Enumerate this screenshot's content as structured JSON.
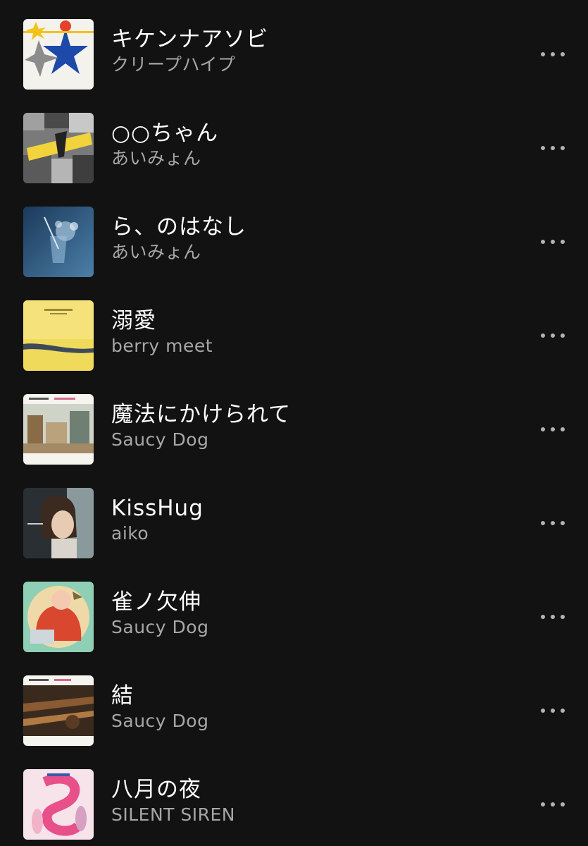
{
  "tracks": [
    {
      "title": "キケンナアソビ",
      "artist": "クリープハイプ",
      "art_icon": "star-album-art"
    },
    {
      "title": "○○ちゃん",
      "artist": "あいみょん",
      "art_icon": "collage-album-art"
    },
    {
      "title": "ら、のはなし",
      "artist": "あいみょん",
      "art_icon": "glass-splash-album-art"
    },
    {
      "title": "溺愛",
      "artist": "berry meet",
      "art_icon": "yellow-landscape-album-art"
    },
    {
      "title": "魔法にかけられて",
      "artist": "Saucy Dog",
      "art_icon": "room-interior-album-art"
    },
    {
      "title": "KissHug",
      "artist": "aiko",
      "art_icon": "portrait-album-art"
    },
    {
      "title": "雀ノ欠伸",
      "artist": "Saucy Dog",
      "art_icon": "illustrated-person-album-art"
    },
    {
      "title": "結",
      "artist": "Saucy Dog",
      "art_icon": "guitar-album-art"
    },
    {
      "title": "八月の夜",
      "artist": "SILENT SIREN",
      "art_icon": "band-pink-album-art"
    }
  ],
  "more_icon": "more-options-icon",
  "colors": {
    "background": "#121212",
    "title": "#ffffff",
    "artist": "#a7a7a7",
    "more_dots": "#b3b3b3"
  }
}
